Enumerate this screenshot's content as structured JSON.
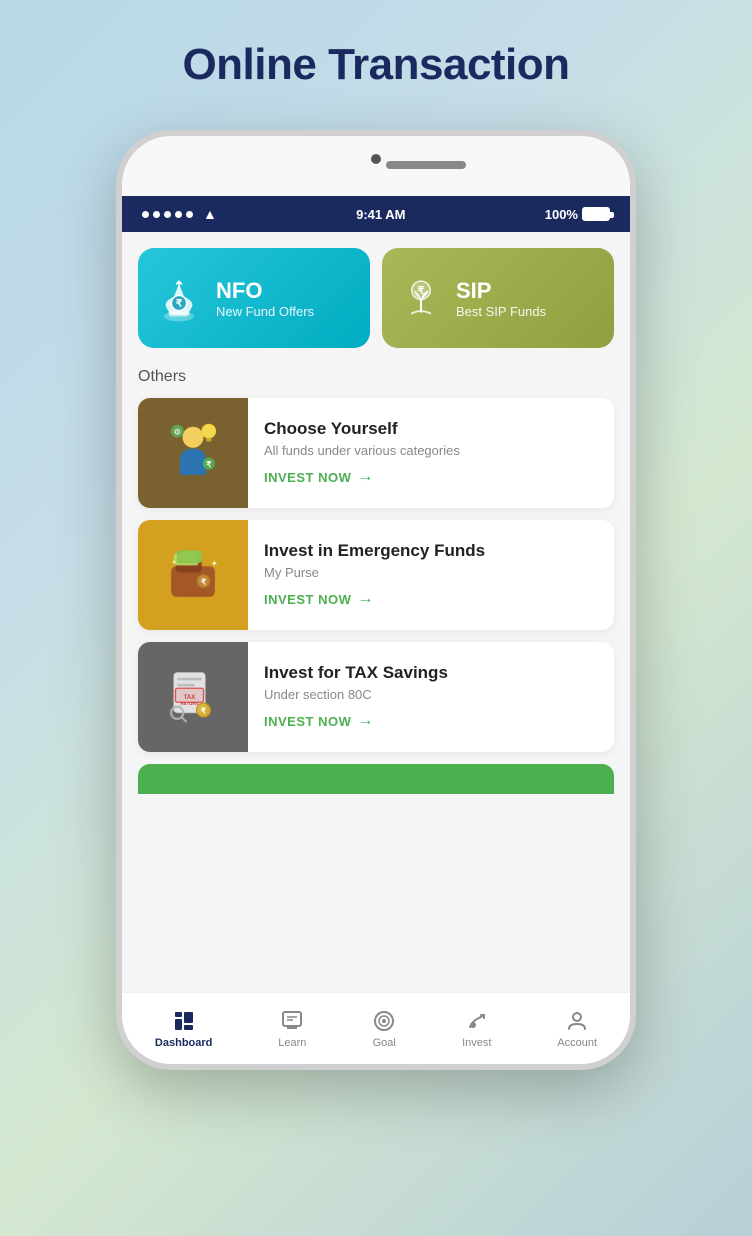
{
  "page": {
    "title": "Online Transaction"
  },
  "status_bar": {
    "dots": 5,
    "time": "9:41 AM",
    "battery": "100%"
  },
  "top_cards": [
    {
      "id": "nfo",
      "title": "NFO",
      "subtitle": "New Fund Offers",
      "color": "cyan"
    },
    {
      "id": "sip",
      "title": "SIP",
      "subtitle": "Best SIP Funds",
      "color": "olive"
    }
  ],
  "section_others_label": "Others",
  "list_items": [
    {
      "title": "Choose Yourself",
      "subtitle": "All funds under various categories",
      "cta": "INVEST NOW",
      "thumb_emoji": "🧑‍💼"
    },
    {
      "title": "Invest in Emergency Funds",
      "subtitle": "My Purse",
      "cta": "INVEST NOW",
      "thumb_emoji": "👜"
    },
    {
      "title": "Invest for TAX Savings",
      "subtitle": "Under section 80C",
      "cta": "INVEST NOW",
      "thumb_emoji": "📄"
    }
  ],
  "bottom_nav": [
    {
      "label": "Dashboard",
      "id": "dashboard",
      "active": true
    },
    {
      "label": "Learn",
      "id": "learn",
      "active": false
    },
    {
      "label": "Goal",
      "id": "goal",
      "active": false
    },
    {
      "label": "Invest",
      "id": "invest",
      "active": false
    },
    {
      "label": "Account",
      "id": "account",
      "active": false
    }
  ]
}
